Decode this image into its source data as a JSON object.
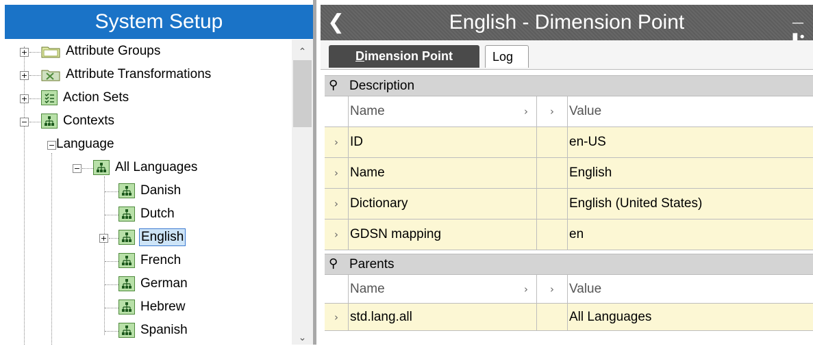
{
  "left_pane": {
    "title": "System Setup",
    "tree": [
      {
        "label": "Attribute Groups"
      },
      {
        "label": "Attribute Transformations"
      },
      {
        "label": "Action Sets"
      },
      {
        "label": "Contexts"
      },
      {
        "label": "Language"
      },
      {
        "label": "All Languages"
      },
      {
        "label": "Danish"
      },
      {
        "label": "Dutch"
      },
      {
        "label": "English"
      },
      {
        "label": "French"
      },
      {
        "label": "German"
      },
      {
        "label": "Hebrew"
      },
      {
        "label": "Spanish"
      }
    ]
  },
  "right_pane": {
    "title": "English - Dimension Point",
    "tabs": [
      {
        "label": "Dimension Point",
        "underline": "D",
        "rest": "imension Point"
      },
      {
        "label": "Log"
      }
    ],
    "description": {
      "section_label": "Description",
      "columns": {
        "name": "Name",
        "value": "Value"
      },
      "rows": [
        {
          "name": "ID",
          "value": "en-US"
        },
        {
          "name": "Name",
          "value": "English"
        },
        {
          "name": "Dictionary",
          "value": "English (United States)"
        },
        {
          "name": "GDSN mapping",
          "value": "en"
        }
      ]
    },
    "parents": {
      "section_label": "Parents",
      "columns": {
        "name": "Name",
        "value": "Value"
      },
      "rows": [
        {
          "name": "std.lang.all",
          "value": "All Languages"
        }
      ]
    }
  },
  "colors": {
    "title_bar": "#1a73c7",
    "header_bar": "#5d5d5d",
    "row_highlight": "#fcf7d4",
    "section_bar": "#d4d4d4",
    "selection": "#cde4f7"
  }
}
